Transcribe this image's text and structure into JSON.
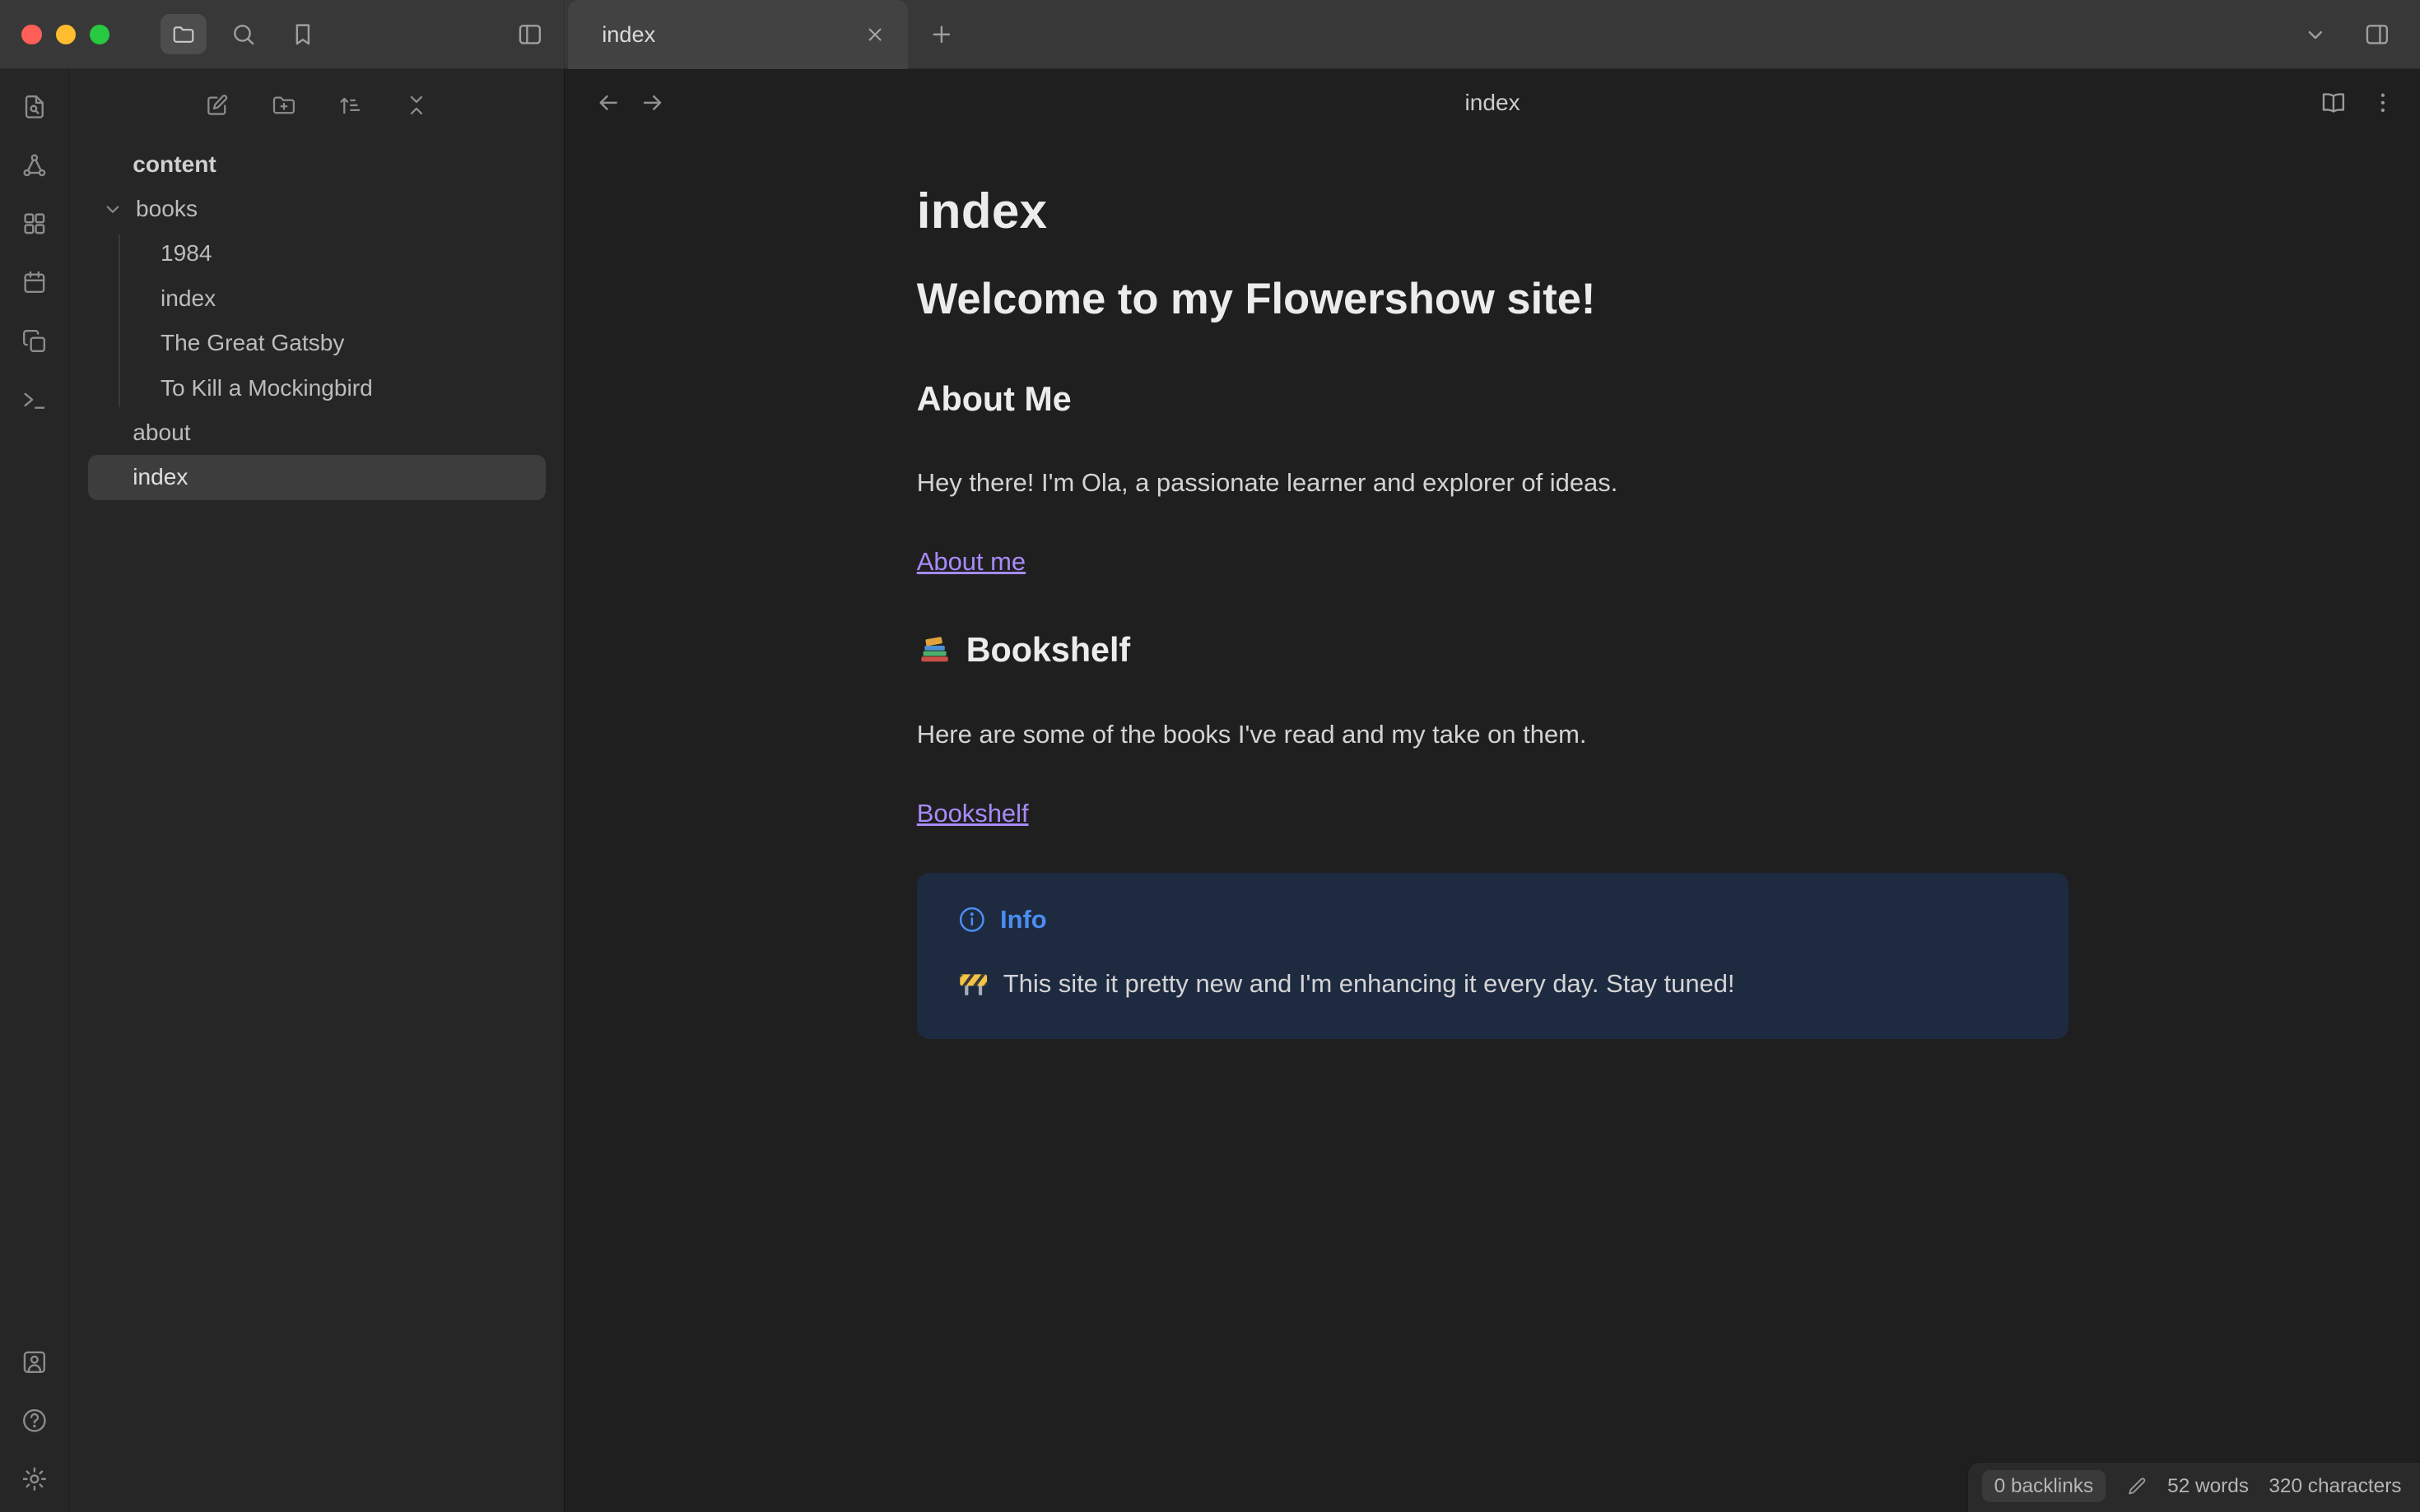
{
  "window": {
    "tab_title": "index"
  },
  "sidebar": {
    "tree": {
      "root": "content",
      "books_folder": "books",
      "books_children": [
        "1984",
        "index",
        "The Great Gatsby",
        "To Kill a Mockingbird"
      ],
      "about": "about",
      "index": "index"
    }
  },
  "main": {
    "header_title": "index",
    "doc": {
      "h1": "index",
      "welcome": "Welcome to my Flowershow site!",
      "about_heading": "About Me",
      "about_text": "Hey there! I'm Ola, a passionate learner and explorer of ideas.",
      "about_link": "About me",
      "bookshelf_emoji": "📚",
      "bookshelf_heading": "Bookshelf",
      "bookshelf_text": "Here are some of the books I've read and my take on them.",
      "bookshelf_link": "Bookshelf",
      "callout": {
        "title": "Info",
        "body_emoji": "🚧",
        "body_text": "This site it pretty new and I'm enhancing it every day. Stay tuned!"
      }
    }
  },
  "statusbar": {
    "backlinks": "0 backlinks",
    "words": "52 words",
    "characters": "320 characters"
  },
  "colors": {
    "accent": "#a78bfa",
    "callout_bg": "#1d2a40",
    "callout_title": "#4c8df0",
    "selected_bg": "#3d3d3d"
  }
}
